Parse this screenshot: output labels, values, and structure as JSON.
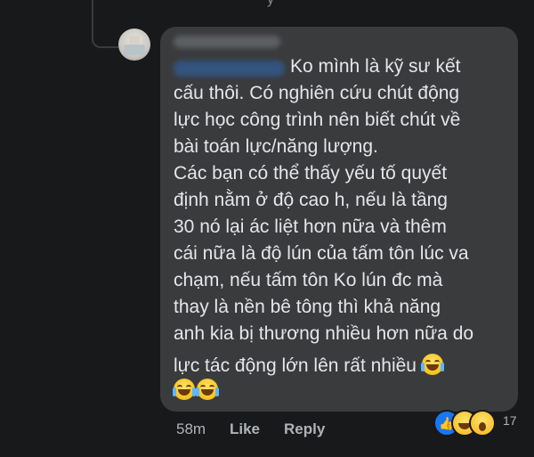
{
  "top_remnant_text": "ỳ",
  "comment": {
    "lines": [
      "Ko mình là kỹ sư kết",
      "cấu thôi. Có nghiên cứu chút động",
      "lực học công trình nên biết chút về",
      "bài toán lực/năng lượng.",
      "Các bạn có thể thấy yếu tố quyết",
      "định nằm ở độ cao h, nếu là tầng",
      "30 nó lại ác liệt hơn nữa và thêm",
      "cái nữa là độ lún của tấm tôn lúc va",
      "chạm, nếu tấm tôn Ko lún đc mà",
      "thay là nền bê tông thì khả năng",
      "anh kia bị thương nhiều hơn nữa do",
      "lực tác động lớn lên rất nhiều"
    ],
    "emoji_inline": "laughing-tears",
    "emoji_row_count": 2
  },
  "actions": {
    "time": "58m",
    "like": "Like",
    "reply": "Reply"
  },
  "reactions": {
    "types": [
      "like",
      "haha",
      "wow"
    ],
    "count": "17"
  },
  "colors": {
    "background": "#18191a",
    "bubble": "#3a3b3c",
    "text": "#e4e6eb",
    "muted": "#b0b3b8",
    "like_blue": "#1877f2"
  }
}
